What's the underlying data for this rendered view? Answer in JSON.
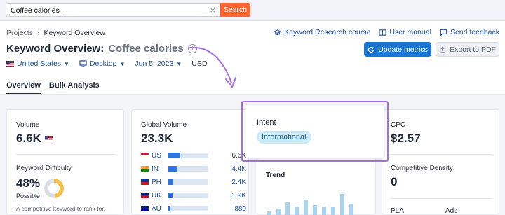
{
  "search": {
    "value": "Coffee calories",
    "button_label": "Search",
    "clear_glyph": "×"
  },
  "breadcrumb": {
    "root": "Projects",
    "separator": "›",
    "current": "Keyword Overview"
  },
  "top_links": [
    {
      "label": "Keyword Research course",
      "icon": "graduation-cap-icon"
    },
    {
      "label": "User manual",
      "icon": "book-icon"
    },
    {
      "label": "Send feedback",
      "icon": "comment-icon"
    }
  ],
  "title": {
    "main": "Keyword Overview:",
    "keyword": "Coffee calories"
  },
  "buttons": {
    "update": "Update metrics",
    "export": "Export to PDF"
  },
  "filters": {
    "country": "United States",
    "device": "Desktop",
    "date": "Jun 5, 2023",
    "currency": "USD"
  },
  "tabs": [
    "Overview",
    "Bulk Analysis"
  ],
  "volume": {
    "label": "Volume",
    "value": "6.6K"
  },
  "difficulty": {
    "label": "Keyword Difficulty",
    "value": "48%",
    "sub": "Possible",
    "description": "A competitive keyword to rank for.",
    "percent": 48
  },
  "global_volume": {
    "label": "Global Volume",
    "value": "23.3K",
    "countries": [
      {
        "code": "US",
        "value": "6.6K",
        "fill": 0.3,
        "colors": [
          "#b22234",
          "#fff"
        ]
      },
      {
        "code": "IN",
        "value": "4.4K",
        "fill": 0.22,
        "colors": [
          "#ff9933",
          "#138808"
        ]
      },
      {
        "code": "PH",
        "value": "2.4K",
        "fill": 0.12,
        "colors": [
          "#0038a8",
          "#ce1126"
        ]
      },
      {
        "code": "UK",
        "value": "1.9K",
        "fill": 0.1,
        "colors": [
          "#012169",
          "#c8102e"
        ]
      },
      {
        "code": "AU",
        "value": "880",
        "fill": 0.05,
        "colors": [
          "#012169",
          "#00008b"
        ]
      }
    ]
  },
  "intent": {
    "label": "Intent",
    "value": "Informational"
  },
  "trend": {
    "label": "Trend",
    "bars": [
      0.15,
      0.25,
      0.45,
      0.3,
      0.55,
      0.35,
      0.3,
      0.28,
      0.75,
      0.4
    ]
  },
  "cpc": {
    "label": "CPC",
    "value": "$2.57"
  },
  "density": {
    "label": "Competitive Density",
    "value": "0"
  },
  "serp": {
    "pla": "PLA",
    "ads": "Ads"
  },
  "colors": {
    "accent_orange": "#ff642d",
    "accent_blue": "#1976d2",
    "highlight_purple": "#a46fdb"
  }
}
